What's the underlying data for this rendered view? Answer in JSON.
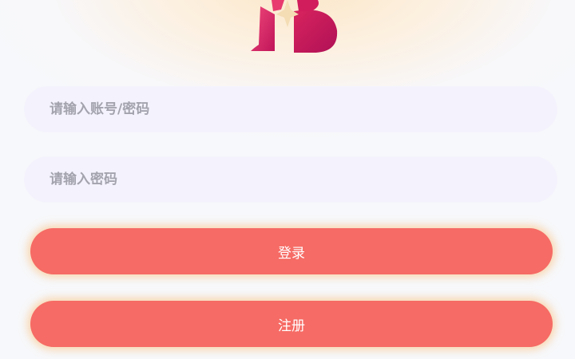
{
  "logo": {
    "icon": "app-logo-icon",
    "colors": [
      "#e2386a",
      "#c4165a",
      "#f2d9b0"
    ]
  },
  "form": {
    "account_placeholder": "请输入账号/密码",
    "password_placeholder": "请输入密码",
    "account_value": "",
    "password_value": ""
  },
  "buttons": {
    "login_label": "登录",
    "register_label": "注册"
  },
  "colors": {
    "button_bg": "#f66b65",
    "field_bg": "#f4f3fd",
    "placeholder": "#a3a3ae"
  }
}
